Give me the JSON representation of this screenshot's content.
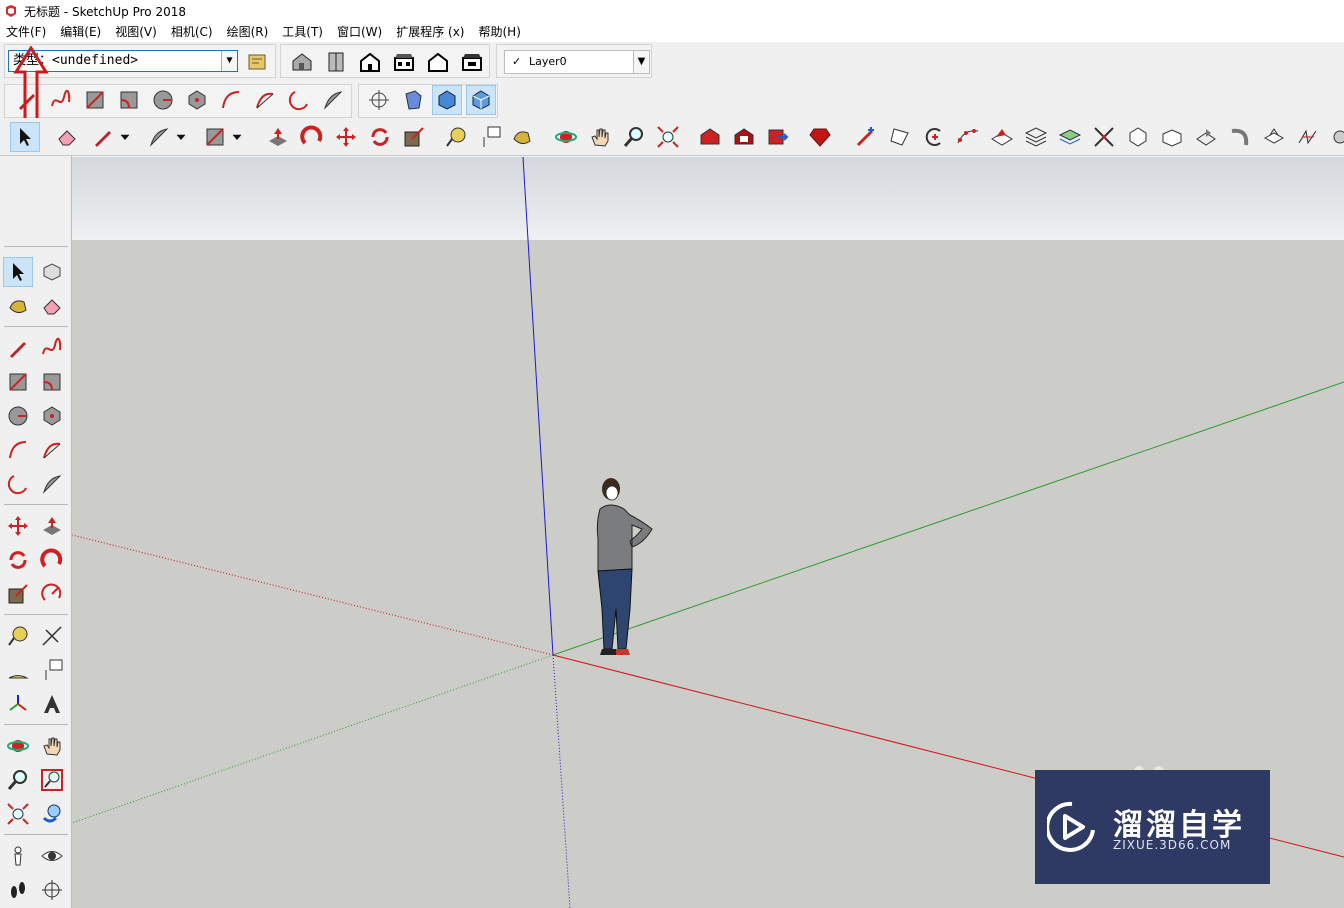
{
  "window": {
    "title": "无标题 - SketchUp Pro 2018"
  },
  "menu": {
    "items": [
      "文件(F)",
      "编辑(E)",
      "视图(V)",
      "相机(C)",
      "绘图(R)",
      "工具(T)",
      "窗口(W)",
      "扩展程序 (x)",
      "帮助(H)"
    ]
  },
  "toolbar": {
    "classification_value": "类型：<undefined>",
    "layer_value": "Layer0"
  },
  "watermark": {
    "title": "溜溜自学",
    "subtitle": "ZIXUE.3D66.COM"
  },
  "colors": {
    "accent_red": "#cc1b1b",
    "axis_red": "#d11414",
    "axis_green": "#2f9d2f",
    "axis_blue": "#1c1cc9",
    "sky": "#dfe3e6",
    "ground": "#ccccc8",
    "watermark_bg": "#2e3a63"
  },
  "icons": {
    "row1": [
      "house-iso-icon",
      "house-top-icon",
      "house-front-icon",
      "house-right-icon",
      "house-back-icon",
      "house-left-icon"
    ],
    "row2": [
      "pencil-icon",
      "freehand-icon",
      "rectangle-icon",
      "rotated-rect-icon",
      "circle-icon",
      "polygon-icon",
      "arc-icon",
      "arc2-icon",
      "arc3-icon",
      "pie-icon",
      "xray-icon",
      "back-edges-icon",
      "wireframe-icon",
      "shaded-icon"
    ],
    "row3": [
      "select-icon",
      "eraser-icon",
      "pencil-icon",
      "arc-icon",
      "rectangle-icon",
      "pushpull-icon",
      "followme-icon",
      "move-icon",
      "rotate-icon",
      "scale-icon",
      "tape-icon",
      "text-icon",
      "paint-icon",
      "orbit-icon",
      "pan-icon",
      "zoom-icon",
      "zoom-extents-icon",
      "warehouse-icon",
      "extension-icon",
      "share-icon",
      "ruby-icon"
    ],
    "left": [
      "select-icon",
      "component-icon",
      "paint-icon",
      "eraser-icon",
      "pencil-icon",
      "freehand-icon",
      "rectangle-icon",
      "rotated-rect-icon",
      "circle-icon",
      "polygon-icon",
      "arc-icon",
      "arc2-icon",
      "arc3-icon",
      "pie-icon",
      "move-icon",
      "pushpull-icon",
      "rotate-icon",
      "followme-icon",
      "scale-icon",
      "offset-icon",
      "tape-icon",
      "dimension-icon",
      "protractor-icon",
      "text-icon",
      "axes-icon",
      "3dtext-icon",
      "orbit-icon",
      "pan-icon",
      "zoom-icon",
      "zoom-window-icon",
      "zoom-extents-icon",
      "previous-icon",
      "position-camera-icon",
      "look-around-icon",
      "walk-icon",
      "section-icon"
    ]
  }
}
